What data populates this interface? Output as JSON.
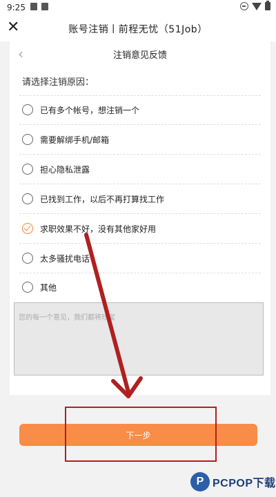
{
  "status_bar": {
    "time": "9:25"
  },
  "header": {
    "close_glyph": "✕",
    "title": "账号注销丨前程无忧（51Job）"
  },
  "subpage": {
    "back_glyph": "‹",
    "title": "注销意见反馈"
  },
  "form": {
    "prompt": "请选择注销原因：",
    "options": [
      {
        "label": "已有多个帐号，想注销一个",
        "checked": false
      },
      {
        "label": "需要解绑手机/邮箱",
        "checked": false
      },
      {
        "label": "担心隐私泄露",
        "checked": false
      },
      {
        "label": "已找到工作，以后不再打算找工作",
        "checked": false
      },
      {
        "label": "求职效果不好，没有其他家好用",
        "checked": true
      },
      {
        "label": "太多骚扰电话",
        "checked": false
      },
      {
        "label": "其他",
        "checked": false
      }
    ],
    "feedback_placeholder": "您的每一个意见，我们都将珍宝",
    "feedback_value": ""
  },
  "next_button": {
    "label": "下一步"
  },
  "watermark": {
    "logo_letter": "P",
    "text": "PCPOP下载"
  },
  "colors": {
    "accent": "#f98c47",
    "annotation": "#b02020"
  }
}
